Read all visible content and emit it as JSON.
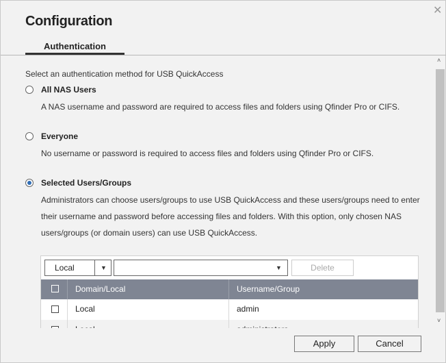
{
  "dialog": {
    "title": "Configuration",
    "close_icon": "close-icon"
  },
  "tabs": [
    {
      "label": "Authentication",
      "active": true
    }
  ],
  "intro": "Select an authentication method for USB QuickAccess",
  "options": [
    {
      "label": "All NAS Users",
      "selected": false,
      "description": "A NAS username and password are required to access files and folders using Qfinder Pro or CIFS."
    },
    {
      "label": "Everyone",
      "selected": false,
      "description": "No username or password is required to access files and folders using Qfinder Pro or CIFS."
    },
    {
      "label": "Selected Users/Groups",
      "selected": true,
      "description": "Administrators can choose users/groups to use USB QuickAccess and these users/groups need to enter their username and password before accessing files and folders. With this option, only chosen NAS users/groups (or domain users) can use USB QuickAccess."
    }
  ],
  "table": {
    "domain_select": "Local",
    "user_select": "",
    "delete_label": "Delete",
    "columns": [
      "Domain/Local",
      "Username/Group"
    ],
    "rows": [
      {
        "domain": "Local",
        "user": "admin",
        "checked": false
      },
      {
        "domain": "Local",
        "user": "administrators",
        "checked": false
      }
    ]
  },
  "footer": {
    "apply": "Apply",
    "cancel": "Cancel"
  },
  "colors": {
    "header": "#7f8593",
    "radio_selected": "#2f6db5"
  }
}
